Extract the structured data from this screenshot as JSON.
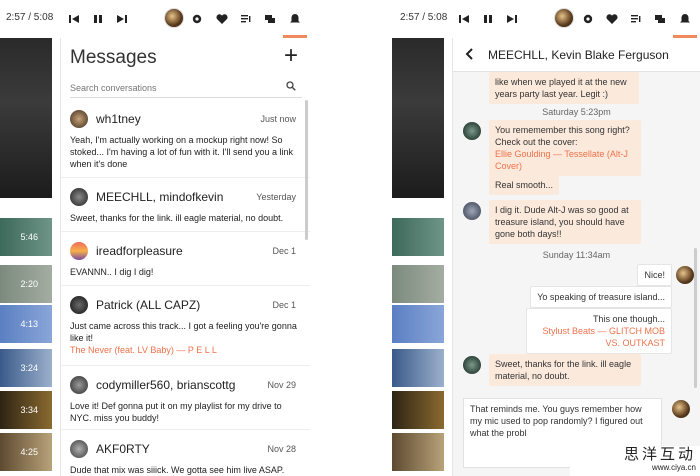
{
  "player": {
    "time": "2:57 / 5:08",
    "icons": [
      "previous-icon",
      "pause-icon",
      "next-icon",
      "settings-icon",
      "heart-icon",
      "playlist-icon",
      "messages-icon",
      "notification-icon"
    ]
  },
  "strip": {
    "durations": [
      "5:46",
      "2:20",
      "4:13",
      "3:24",
      "3:34",
      "4:25"
    ]
  },
  "messages": {
    "title": "Messages",
    "new_label": "+",
    "search_placeholder": "Search conversations",
    "conversations": [
      {
        "name": "wh1tney",
        "when": "Just now",
        "preview": "Yeah, I'm actually working on a mockup right now! So stoked... I'm having a lot of fun with it. I'll send you a link when it's done",
        "link": ""
      },
      {
        "name": "MEECHLL, mindofkevin",
        "when": "Yesterday",
        "preview": "Sweet, thanks for the link. ill eagle material, no doubt.",
        "link": ""
      },
      {
        "name": "ireadforpleasure",
        "when": "Dec 1",
        "preview": "EVANNN.. I dig I dig!",
        "link": ""
      },
      {
        "name": "Patrick (ALL CAPZ)",
        "when": "Dec 1",
        "preview": "Just came across this track... I got a feeling you're gonna like it!",
        "link": "The Never (feat. LV Baby) — P E L L"
      },
      {
        "name": "codymiller560, brianscottg",
        "when": "Nov 29",
        "preview": "Love it! Def gonna put it on my playlist for my drive to NYC. miss you buddy!",
        "link": ""
      },
      {
        "name": "AKF0RTY",
        "when": "Nov 28",
        "preview": "Dude that mix was siiick. We gotta see him live ASAP.",
        "link": ""
      }
    ]
  },
  "chat": {
    "title": "MEECHLL, Kevin Blake Ferguson",
    "top_bubble": "like when we played it at the new years party last year. Legit :)",
    "day1": "Saturday 5:23pm",
    "m1": "You rememember this song right? Check out the cover:",
    "m1_link": "Ellie Goulding — Tessellate (Alt-J Cover)",
    "m2": "Real smooth...",
    "m3": "I dig it. Dude Alt-J was so good at treasure island, you should have gone both days!!",
    "day2": "Sunday 11:34am",
    "o1": "Nice!",
    "o2": "Yo speaking of treasure island...",
    "o3": "This one though...",
    "o3_link": "Stylust Beats —  GLITCH MOB VS. OUTKAST",
    "m4": "Sweet, thanks for the link. ill eagle material, no doubt.",
    "compose": "That reminds me. You guys remember how my mic used to pop randomly? I figured out what the probl"
  },
  "watermark": {
    "cn": "思洋互动",
    "url": "www.ciya.cn"
  },
  "colors": {
    "accent": "#f08a5d",
    "link": "#f0714a",
    "incoming_bubble": "#fbe9dc"
  }
}
